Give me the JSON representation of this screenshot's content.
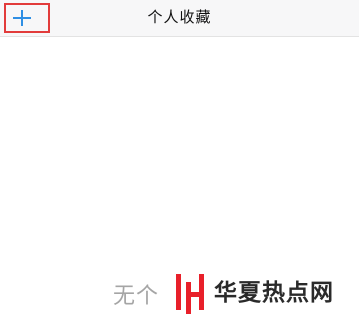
{
  "nav": {
    "title": "个人收藏",
    "add_icon": "plus-icon",
    "accent_color": "#2f8fe4",
    "highlight_color": "#e23b3b"
  },
  "empty_state": {
    "text": "无个"
  },
  "watermark": {
    "text": "华夏热点网",
    "logo_color": "#e8202a"
  }
}
